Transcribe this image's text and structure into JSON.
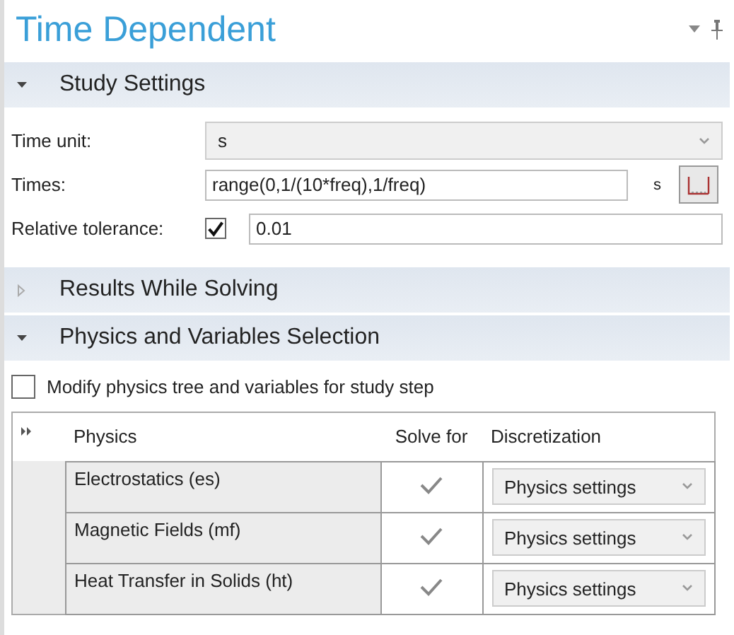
{
  "title": "Time Dependent",
  "study_settings": {
    "label": "Study Settings",
    "expanded": true,
    "time_unit": {
      "label": "Time unit:",
      "value": "s"
    },
    "times": {
      "label": "Times:",
      "value": "range(0,1/(10*freq),1/freq)",
      "unit": "s"
    },
    "relative_tolerance": {
      "label": "Relative tolerance:",
      "checked": true,
      "value": "0.01"
    }
  },
  "results_while_solving": {
    "label": "Results While Solving",
    "expanded": false
  },
  "physics_selection": {
    "label": "Physics and Variables Selection",
    "expanded": true,
    "modify": {
      "label": "Modify physics tree and variables for study step",
      "checked": false
    },
    "table": {
      "columns": [
        "Physics",
        "Solve for",
        "Discretization"
      ],
      "rows": [
        {
          "physics": "Electrostatics (es)",
          "solve_for": true,
          "discretization": "Physics settings"
        },
        {
          "physics": "Magnetic Fields (mf)",
          "solve_for": true,
          "discretization": "Physics settings"
        },
        {
          "physics": "Heat Transfer in Solids (ht)",
          "solve_for": true,
          "discretization": "Physics settings"
        }
      ]
    }
  }
}
